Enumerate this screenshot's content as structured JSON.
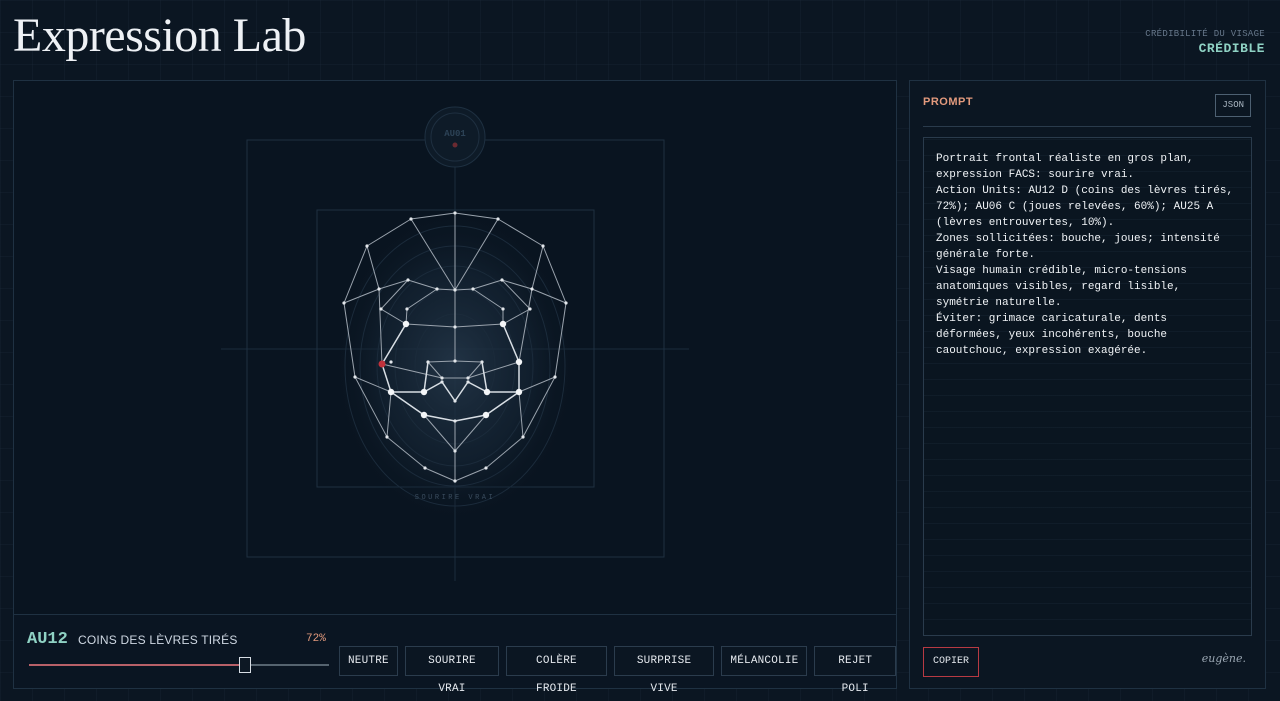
{
  "app": {
    "title": "Expression Lab",
    "credibility_label": "CRÉDIBILITÉ DU VISAGE",
    "credibility_value": "CRÉDIBLE"
  },
  "visualization": {
    "badge_label": "AU01",
    "caption": "SOURIRE VRAI"
  },
  "action_unit": {
    "code": "AU12",
    "name": "COINS DES LÈVRES TIRÉS",
    "intensity_label": "72%",
    "intensity": 0.72
  },
  "presets": [
    "NEUTRE",
    "SOURIRE VRAI",
    "COLÈRE FROIDE",
    "SURPRISE VIVE",
    "MÉLANCOLIE",
    "REJET POLI"
  ],
  "prompt_panel": {
    "title": "PROMPT",
    "json_button": "JSON",
    "text": "Portrait frontal réaliste en gros plan,\nexpression FACS: sourire vrai.\nAction Units: AU12 D (coins des lèvres tirés,\n72%); AU06 C (joues relevées, 60%); AU25 A\n(lèvres entrouvertes, 10%).\nZones sollicitées: bouche, joues; intensité\ngénérale forte.\nVisage humain crédible, micro-tensions\nanatomiques visibles, regard lisible,\nsymétrie naturelle.\nÉviter: grimace caricaturale, dents\ndéformées, yeux incohérents, bouche\ncaoutchouc, expression exagérée.",
    "copy_button": "COPIER",
    "signature": "eugène."
  },
  "colors": {
    "accent_teal": "#8fd2c4",
    "accent_orange": "#e39a7d",
    "accent_red": "#c0323c",
    "background": "#0b1622"
  }
}
